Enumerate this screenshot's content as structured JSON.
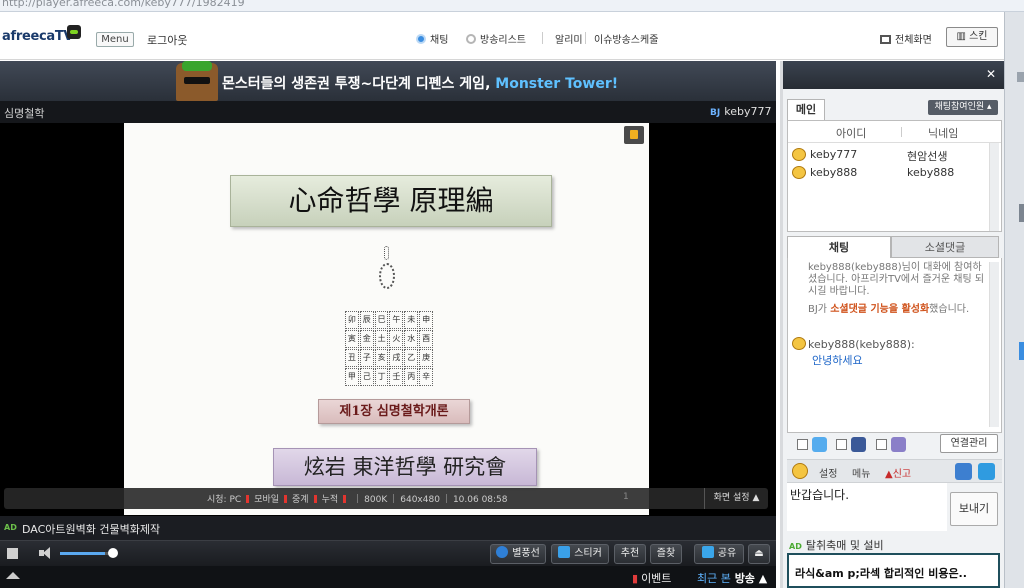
{
  "browser": {
    "url": "http://player.afreeca.com/keby777/1982419"
  },
  "header": {
    "logo": "afreecaTV",
    "menu_label": "Menu",
    "logout_label": "로그아웃",
    "nav": {
      "chat": "채팅",
      "broadcast_list": "방송리스트",
      "alarm": "알리미",
      "issue_schedule": "이슈방송스케줄"
    },
    "fullscreen_label": "전체화면",
    "skin_label": "스킨"
  },
  "player": {
    "banner_text": "몬스터들의 생존권 투쟁~다단계 디펜스 게임, ",
    "banner_highlight": "Monster Tower!",
    "broadcast_title": "심명철학",
    "bj_tag": "BJ",
    "bj_id": "keby777",
    "slide": {
      "title": "心命哲學 原理編",
      "subtitle": "제1장 심명철학개론",
      "org": "炫岩 東洋哲學 研究會",
      "grid_cells": [
        "卯",
        "辰",
        "巳",
        "午",
        "未",
        "申",
        "寅",
        "金",
        "土",
        "火",
        "水",
        "酉",
        "丑",
        "子",
        "亥",
        "戌",
        "乙",
        "庚",
        "甲",
        "己",
        "丁",
        "壬",
        "丙",
        "辛"
      ]
    },
    "status": {
      "viewers_label": "시청:",
      "pc": "PC",
      "mobile": "모바일",
      "relay": "중계",
      "cumulative": "누적",
      "bitrate": "800K",
      "resolution": "640x480",
      "timestamp": "10.06 08:58",
      "counter": "1"
    },
    "screen_settings_label": "화면 설정 ▲",
    "ad_tag": "AD",
    "ad_text": "DAC아트원벽화 건물벽화제작",
    "volume": 0.8,
    "controls": {
      "balloon": "별풍선",
      "sticker": "스티커",
      "recommend": "추천",
      "favorite": "즐찾",
      "share": "공유"
    },
    "bottom": {
      "event": "이벤트",
      "recent_prefix": "최근 본",
      "recent_suffix": " 방송 ▲"
    }
  },
  "chat_panel": {
    "close": "✕",
    "tab_main": "메인",
    "participants_label": "채팅참여인원 ▴",
    "col_id": "아이디",
    "col_nick": "닉네임",
    "users": [
      {
        "id": "keby777",
        "nick": "현암선생"
      },
      {
        "id": "keby888",
        "nick": "keby888"
      }
    ],
    "tab_chat": "채팅",
    "tab_social": "소셜댓글",
    "system_msg_1": "keby888(keby888)님이 대화에 참여하셨습니다. 아프리카TV에서 즐거운 채팅 되시길 바랍니다.",
    "system_msg_2_pre": "BJ가 ",
    "system_msg_2_bold": "소셜댓글 기능을 활성화",
    "system_msg_2_post": "했습니다.",
    "chat_user": "keby888(keby888):",
    "chat_text": "안녕하세요",
    "link_manage": "연결관리",
    "settings": "설정",
    "menu": "메뉴",
    "report": "신고",
    "input_value": "반갑습니다.",
    "send": "보내기",
    "ad_tag": "AD",
    "ad_text": "탈취축매 및 설비",
    "ad_box": "라식&am p;라섹 합리적인 비용은.."
  }
}
